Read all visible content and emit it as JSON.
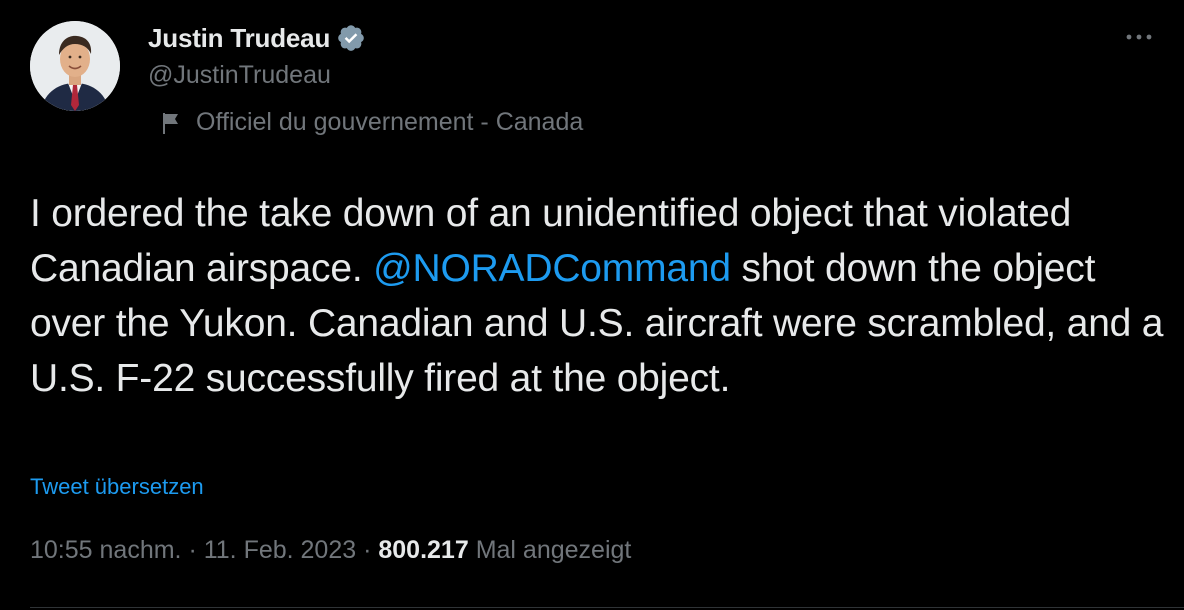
{
  "author": {
    "display_name": "Justin Trudeau",
    "handle": "@JustinTrudeau",
    "affiliation": "Officiel du gouvernement - Canada",
    "avatar_icon": "profile-photo",
    "verified_icon": "verified-badge-icon"
  },
  "tweet": {
    "text_before_mention": "I ordered the take down of an unidentified object that violated Canadian airspace. ",
    "mention": "@NORADCommand",
    "text_after_mention": " shot down the object over the Yukon. Canadian and U.S. aircraft were scrambled, and a U.S. F-22 successfully fired at the object.",
    "translate_label": "Tweet übersetzen"
  },
  "meta": {
    "time": "10:55 nachm.",
    "separator": " · ",
    "date": "11. Feb. 2023",
    "views_count": "800.217",
    "views_label": "Mal angezeigt"
  },
  "colors": {
    "background": "#000000",
    "text": "#e7e9ea",
    "secondary": "#71767b",
    "accent": "#1d9bf0",
    "verified": "#829aab"
  }
}
